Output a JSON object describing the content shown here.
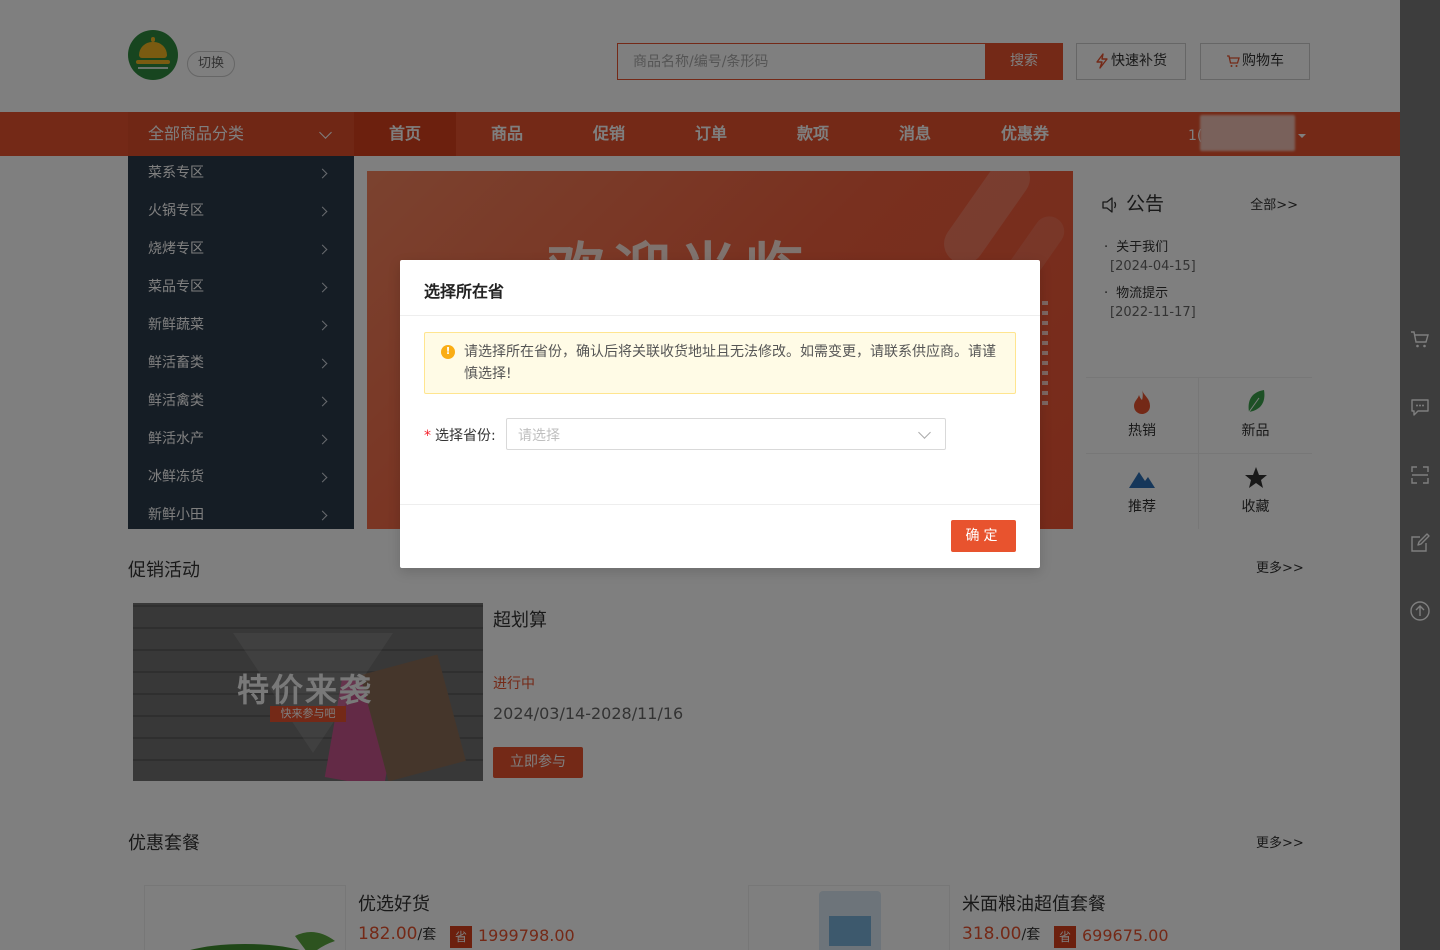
{
  "header": {
    "switch_label": "切换",
    "search_placeholder": "商品名称/编号/条形码",
    "search_button": "搜索",
    "quick_restock": "快速补货",
    "cart": "购物车"
  },
  "nav": {
    "category_label": "全部商品分类",
    "items": [
      "首页",
      "商品",
      "促销",
      "订单",
      "款项",
      "消息",
      "优惠券"
    ],
    "active_index": 0,
    "user_prefix": "1("
  },
  "sidebar": {
    "items": [
      "菜系专区",
      "火锅专区",
      "烧烤专区",
      "菜品专区",
      "新鲜蔬菜",
      "鲜活畜类",
      "鲜活禽类",
      "鲜活水产",
      "冰鲜冻货",
      "新鲜小田"
    ]
  },
  "banner": {
    "title": "欢迎光临"
  },
  "notice": {
    "title": "公告",
    "all_link": "全部>>",
    "items": [
      {
        "title": "关于我们",
        "date": "[2024-04-15]"
      },
      {
        "title": "物流提示",
        "date": "[2022-11-17]"
      }
    ]
  },
  "quick_links": [
    {
      "label": "热销",
      "icon": "flame-icon",
      "color": "#e8532e"
    },
    {
      "label": "新品",
      "icon": "leaf-icon",
      "color": "#3aa14a"
    },
    {
      "label": "推荐",
      "icon": "mountain-icon",
      "color": "#2d6fb5"
    },
    {
      "label": "收藏",
      "icon": "star-icon",
      "color": "#333333"
    }
  ],
  "promotions": {
    "title": "促销活动",
    "more": "更多>>",
    "card": {
      "image_text": "特价来袭",
      "image_tag": "快来参与吧",
      "name": "超划算",
      "status": "进行中",
      "date_range": "2024/03/14-2028/11/16",
      "join_button": "立即参与"
    }
  },
  "packages": {
    "title": "优惠套餐",
    "more": "更多>>",
    "items": [
      {
        "name": "优选好货",
        "price": "182.00",
        "unit": "/套",
        "save_badge": "省",
        "save": "1999798.00"
      },
      {
        "name": "米面粮油超值套餐",
        "price": "318.00",
        "unit": "/套",
        "save_badge": "省",
        "save": "699675.00"
      }
    ]
  },
  "right_rail": [
    "cart-icon",
    "message-icon",
    "scan-icon",
    "edit-icon",
    "back-to-top-icon"
  ],
  "modal": {
    "title": "选择所在省",
    "alert": "请选择所在省份，确认后将关联收货地址且无法修改。如需变更，请联系供应商。请谨慎选择!",
    "label": "选择省份:",
    "required_mark": "*",
    "select_placeholder": "请选择",
    "ok_button": "确定"
  },
  "colors": {
    "brand": "#e8532e",
    "sidebar_bg": "#2b3a4a",
    "warning": "#faad14"
  }
}
